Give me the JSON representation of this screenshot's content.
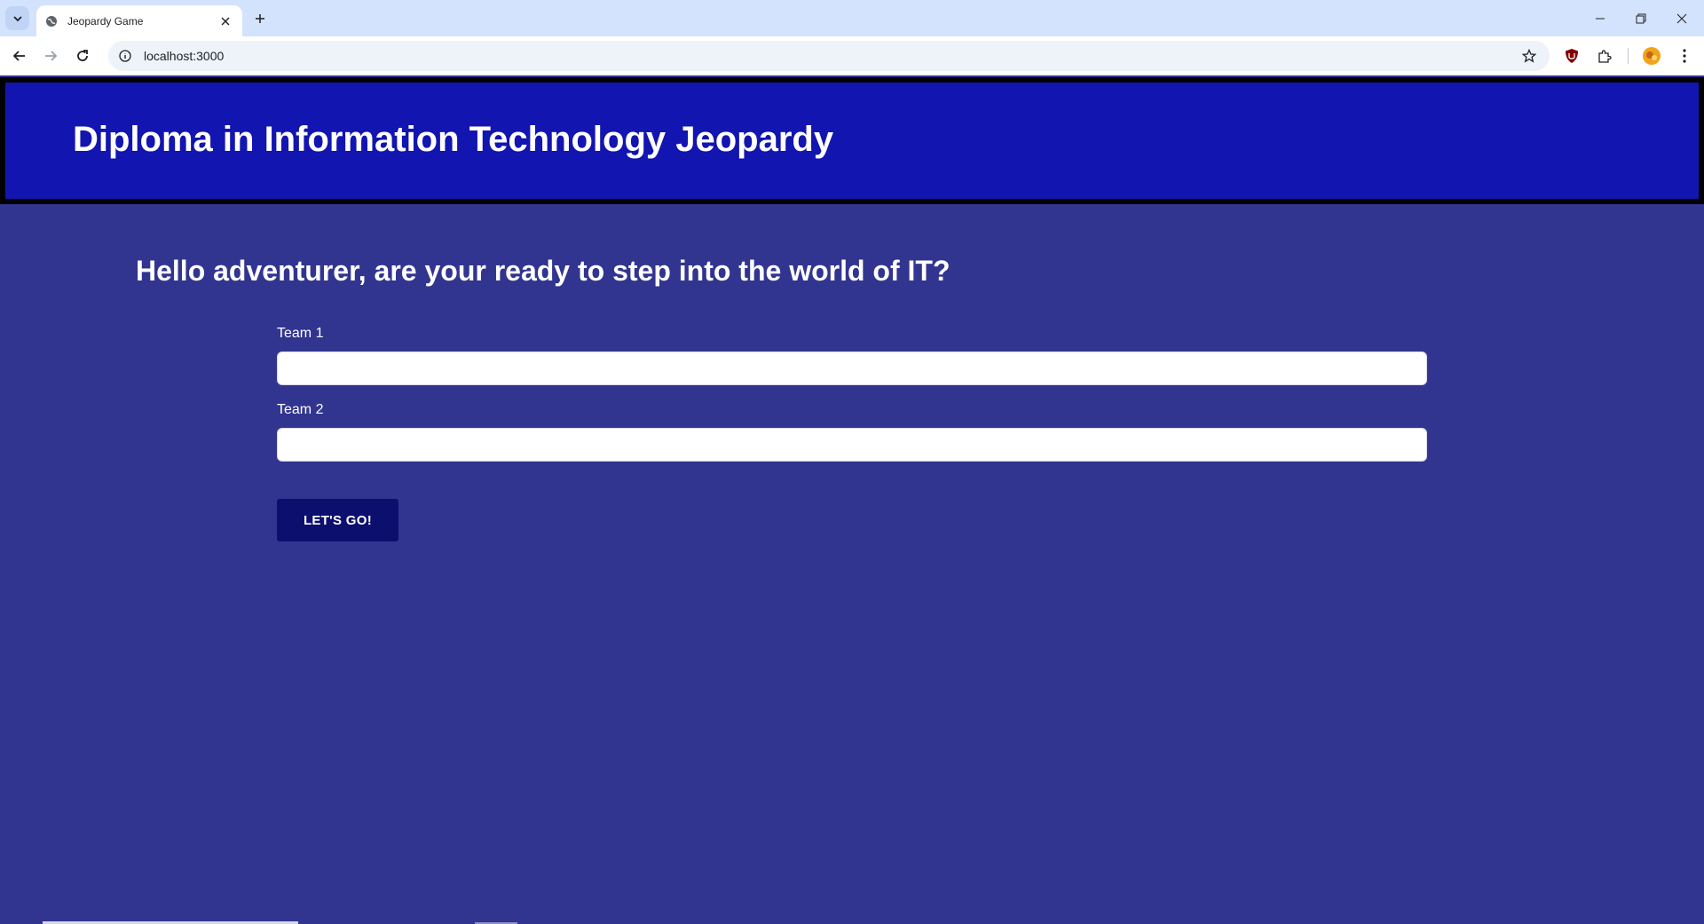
{
  "browser": {
    "tab_title": "Jeopardy Game",
    "url": "localhost:3000"
  },
  "page": {
    "header_title": "Diploma in Information Technology Jeopardy",
    "greeting": "Hello adventurer, are your ready to step into the world of IT?",
    "team1_label": "Team 1",
    "team1_value": "",
    "team2_label": "Team 2",
    "team2_value": "",
    "submit_label": "LET'S GO!"
  },
  "colors": {
    "page_background": "#31358f",
    "header_background": "#1215b0",
    "button_background": "#0d0f6f"
  }
}
